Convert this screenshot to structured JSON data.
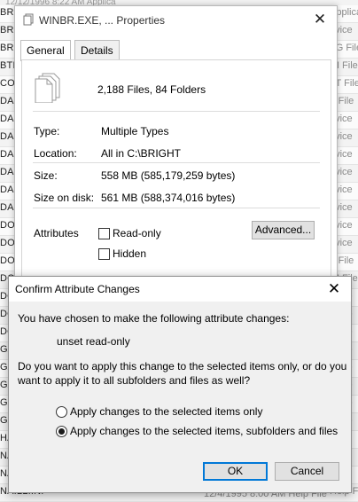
{
  "background": {
    "top_text": "12/12/1996 8:22 AM     Applica",
    "left_col": [
      "BR.EXE",
      "BRS",
      "BRS",
      "BTL",
      "COI",
      "DAC",
      "DAC",
      "DAC",
      "DAC",
      "DAC",
      "DAC",
      "DAC",
      "DOS",
      "DOS",
      "DOS",
      "DOS",
      "DOS",
      "DOS",
      "DOS",
      "GA",
      "GA",
      "GA",
      "GA",
      "GA",
      "HA",
      "NA",
      "NA",
      "NAILL.INI"
    ],
    "right_col": [
      "Applica",
      "evice",
      "FG File",
      "RI File",
      "AT File",
      "T File",
      "evice",
      "evice",
      "evice",
      "evice",
      "evice",
      "evice",
      "evice",
      "evice",
      "T File",
      "RI File",
      "evice",
      "evice",
      "evice",
      "evice",
      "evice",
      "evice",
      "evice",
      "evice",
      "ile",
      "ile",
      "ile",
      "Help File"
    ],
    "bottom_text": "12/4/1995 8:00 AM     Help File"
  },
  "properties": {
    "title": "WINBR.EXE, ... Properties",
    "tabs": [
      "General",
      "Details"
    ],
    "summary": "2,188 Files, 84 Folders",
    "type_label": "Type:",
    "type_value": "Multiple Types",
    "location_label": "Location:",
    "location_value": "All in C:\\BRIGHT",
    "size_label": "Size:",
    "size_value": "558 MB (585,179,259 bytes)",
    "size_on_disk_label": "Size on disk:",
    "size_on_disk_value": "561 MB (588,374,016 bytes)",
    "attributes_label": "Attributes",
    "readonly_label": "Read-only",
    "hidden_label": "Hidden",
    "advanced_label": "Advanced...",
    "close_glyph": "✕"
  },
  "dialog": {
    "title": "Confirm Attribute Changes",
    "close_glyph": "✕",
    "intro": "You have chosen to make the following attribute changes:",
    "change": "unset read-only",
    "question_line1": "Do you want to apply this change to the selected items only, or do you",
    "question_line2": "want to apply it to all subfolders and files as well?",
    "option1": "Apply changes to the selected items only",
    "option2": "Apply changes to the selected items, subfolders and files",
    "ok_label": "OK",
    "cancel_label": "Cancel"
  },
  "colors": {
    "focus_blue": "#0078d7"
  }
}
